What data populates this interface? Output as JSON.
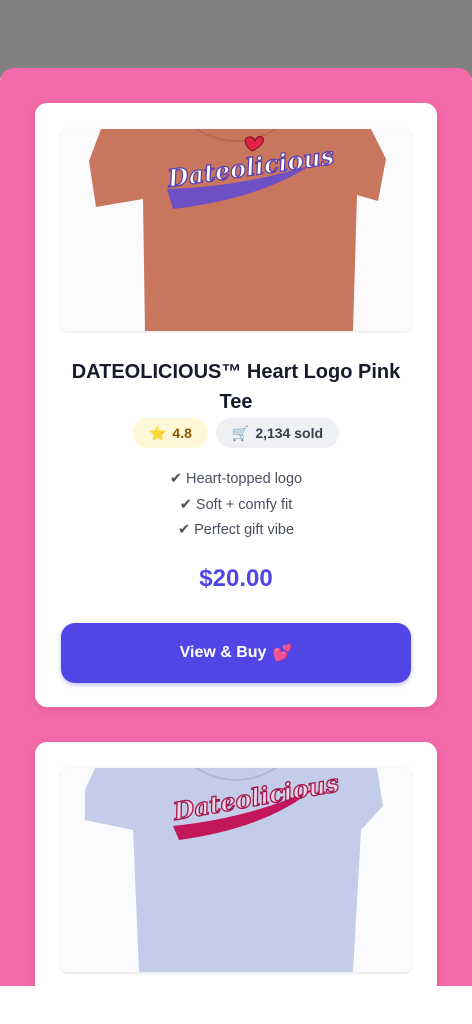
{
  "products": [
    {
      "title": "DATEOLICIOUS™ Heart Logo Pink Tee",
      "logo_text": "Dateolicious",
      "shirt_color": "#c9765f",
      "rating": "4.8",
      "rating_icon": "star-icon",
      "sold": "2,134 sold",
      "sold_icon": "cart-icon",
      "features": [
        "✔ Heart-topped logo",
        "✔ Soft + comfy fit",
        "✔ Perfect gift vibe"
      ],
      "price": "$20.00",
      "button_label": "View & Buy",
      "button_icon": "hearts-icon"
    },
    {
      "logo_text": "Dateolicious",
      "shirt_color": "#c3cce8"
    }
  ],
  "colors": {
    "page_background": "#f56aaa",
    "accent": "#4f46e5",
    "top_bar": "#808080"
  }
}
